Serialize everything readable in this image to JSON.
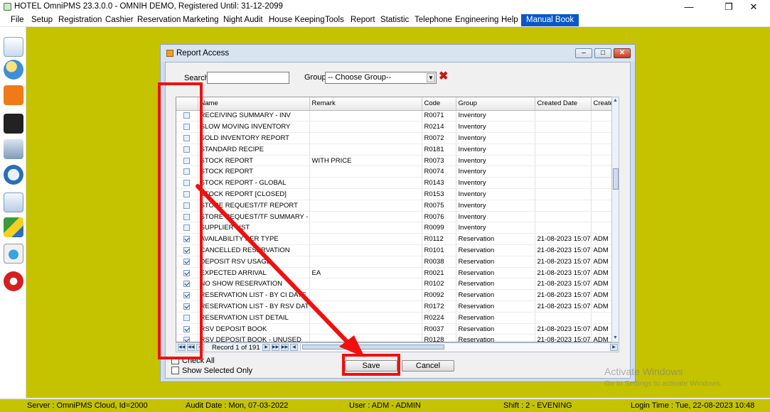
{
  "window": {
    "title": "HOTEL OmniPMS 23.3.0.0 - OMNIH DEMO, Registered Until: 31-12-2099"
  },
  "menu": [
    "File",
    "Setup",
    "Registration",
    "Cashier",
    "Reservation",
    "Marketing",
    "Night Audit",
    "House Keeping",
    "Tools",
    "Report",
    "Statistic",
    "Telephone",
    "Engineering",
    "Help",
    "Manual Book"
  ],
  "toolbar_icons": [
    "registration-icon",
    "guests-icon",
    "reservation-icon",
    "calendar-icon",
    "database-icon",
    "rooms-icon",
    "shop-icon",
    "chart-icon",
    "report-icon",
    "power-icon"
  ],
  "dialog": {
    "title": "Report Access",
    "search_label": "Search",
    "search_value": "",
    "group_label": "Group",
    "group_value": "-- Choose Group--",
    "columns": [
      "",
      "Name",
      "Remark",
      "Code",
      "Group",
      "Created Date",
      "Created I"
    ],
    "rows": [
      {
        "checked": false,
        "name": "RECEIVING SUMMARY - INV",
        "remark": "",
        "code": "R0071",
        "group": "Inventory",
        "date": "",
        "by": ""
      },
      {
        "checked": false,
        "name": "SLOW MOVING INVENTORY",
        "remark": "",
        "code": "R0214",
        "group": "Inventory",
        "date": "",
        "by": ""
      },
      {
        "checked": false,
        "name": "SOLD INVENTORY REPORT",
        "remark": "",
        "code": "R0072",
        "group": "Inventory",
        "date": "",
        "by": ""
      },
      {
        "checked": false,
        "name": "STANDARD RECIPE",
        "remark": "",
        "code": "R0181",
        "group": "Inventory",
        "date": "",
        "by": ""
      },
      {
        "checked": false,
        "name": "STOCK REPORT",
        "remark": "WITH PRICE",
        "code": "R0073",
        "group": "Inventory",
        "date": "",
        "by": ""
      },
      {
        "checked": false,
        "name": "STOCK REPORT",
        "remark": "",
        "code": "R0074",
        "group": "Inventory",
        "date": "",
        "by": ""
      },
      {
        "checked": false,
        "name": "STOCK REPORT - GLOBAL",
        "remark": "",
        "code": "R0143",
        "group": "Inventory",
        "date": "",
        "by": ""
      },
      {
        "checked": false,
        "name": "STOCK REPORT [CLOSED]",
        "remark": "",
        "code": "R0153",
        "group": "Inventory",
        "date": "",
        "by": ""
      },
      {
        "checked": false,
        "name": "STORE REQUEST/TF REPORT",
        "remark": "",
        "code": "R0075",
        "group": "Inventory",
        "date": "",
        "by": ""
      },
      {
        "checked": false,
        "name": "STORE REQUEST/TF SUMMARY - INV",
        "remark": "",
        "code": "R0076",
        "group": "Inventory",
        "date": "",
        "by": ""
      },
      {
        "checked": false,
        "name": "SUPPLIER LIST",
        "remark": "",
        "code": "R0099",
        "group": "Inventory",
        "date": "",
        "by": ""
      },
      {
        "checked": true,
        "name": "AVAILABILITY PER TYPE",
        "remark": "",
        "code": "R0112",
        "group": "Reservation",
        "date": "21-08-2023 15:07",
        "by": "ADM"
      },
      {
        "checked": true,
        "name": "CANCELLED RESERVATION",
        "remark": "",
        "code": "R0101",
        "group": "Reservation",
        "date": "21-08-2023 15:07",
        "by": "ADM"
      },
      {
        "checked": true,
        "name": "DEPOSIT RSV USAGE",
        "remark": "",
        "code": "R0038",
        "group": "Reservation",
        "date": "21-08-2023 15:07",
        "by": "ADM"
      },
      {
        "checked": true,
        "name": "EXPECTED ARRIVAL",
        "remark": "EA",
        "code": "R0021",
        "group": "Reservation",
        "date": "21-08-2023 15:07",
        "by": "ADM"
      },
      {
        "checked": true,
        "name": "NO SHOW RESERVATION",
        "remark": "",
        "code": "R0102",
        "group": "Reservation",
        "date": "21-08-2023 15:07",
        "by": "ADM"
      },
      {
        "checked": true,
        "name": "RESERVATION LIST - BY CI DATE",
        "remark": "",
        "code": "R0092",
        "group": "Reservation",
        "date": "21-08-2023 15:07",
        "by": "ADM"
      },
      {
        "checked": true,
        "name": "RESERVATION LIST - BY RSV DATE",
        "remark": "",
        "code": "R0172",
        "group": "Reservation",
        "date": "21-08-2023 15:07",
        "by": "ADM"
      },
      {
        "checked": false,
        "name": "RESERVATION LIST DETAIL",
        "remark": "",
        "code": "R0224",
        "group": "Reservation",
        "date": "",
        "by": ""
      },
      {
        "checked": true,
        "name": "RSV DEPOSIT BOOK",
        "remark": "",
        "code": "R0037",
        "group": "Reservation",
        "date": "21-08-2023 15:07",
        "by": "ADM"
      },
      {
        "checked": true,
        "name": "RSV DEPOSIT BOOK - UNUSED",
        "remark": "",
        "code": "R0128",
        "group": "Reservation",
        "date": "21-08-2023 15:07",
        "by": "ADM"
      }
    ],
    "record_text": "Record 1 of 191",
    "check_all_label": "Check All",
    "show_selected_label": "Show Selected Only",
    "save_label": "Save",
    "cancel_label": "Cancel"
  },
  "watermark": {
    "title": "Activate Windows",
    "sub": "Go to Settings to activate Windows."
  },
  "status": {
    "server": "Server : OmniPMS Cloud, Id=2000",
    "audit": "Audit Date : Mon, 07-03-2022",
    "user": "User : ADM - ADMIN",
    "shift": "Shift : 2 - EVENING",
    "login": "Login Time : Tue, 22-08-2023 10:48"
  },
  "colors": {
    "workspace": "#c5c300",
    "annotation": "#f01010",
    "menu_active": "#0a57c9"
  }
}
